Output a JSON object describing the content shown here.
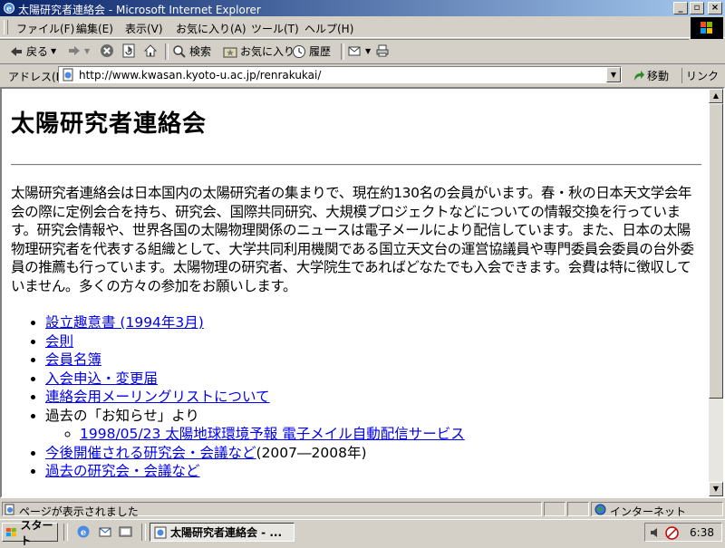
{
  "window": {
    "title": "太陽研究者連絡会 - Microsoft Internet Explorer"
  },
  "menu": [
    "ファイル(F)",
    "編集(E)",
    "表示(V)",
    "お気に入り(A)",
    "ツール(T)",
    "ヘルプ(H)"
  ],
  "toolbar": {
    "back": "戻る",
    "search": "検索",
    "favorites": "お気に入り",
    "history": "履歴"
  },
  "address": {
    "label": "アドレス(D)",
    "url": "http://www.kwasan.kyoto-u.ac.jp/renrakukai/",
    "go": "移動",
    "links": "リンク"
  },
  "page": {
    "heading": "太陽研究者連絡会",
    "intro": "太陽研究者連絡会は日本国内の太陽研究者の集まりで、現在約130名の会員がいます。春・秋の日本天文学会年会の際に定例会合を持ち、研究会、国際共同研究、大規模プロジェクトなどについての情報交換を行っています。研究会情報や、世界各国の太陽物理関係のニュースは電子メールにより配信しています。また、日本の太陽物理研究者を代表する組織として、大学共同利用機関である国立天文台の運営協議員や専門委員会委員の台外委員の推薦も行っています。太陽物理の研究者、大学院生であればどなたでも入会できます。会費は特に徴収していません。多くの方々の参加をお願いします。",
    "links": {
      "prospectus": "設立趣意書 (1994年3月)",
      "rules": "会則",
      "members": "会員名簿",
      "join": "入会申込・変更届",
      "mailinglist": "連絡会用メーリングリストについて",
      "news_label": "過去の「お知らせ」より",
      "news_item": "1998/05/23 太陽地球環境予報 電子メイル自動配信サービス",
      "upcoming": "今後開催される研究会・会議など",
      "upcoming_note": "(2007―2008年)",
      "past": "過去の研究会・会議など"
    }
  },
  "status": {
    "text": "ページが表示されました",
    "zone": "インターネット"
  },
  "taskbar": {
    "start": "スタート",
    "task": "太陽研究者連絡会 - ...",
    "clock": "6:38"
  },
  "icons": {
    "ie": "ie-logo-icon",
    "back": "back-arrow-icon",
    "forward": "forward-arrow-icon",
    "stop": "stop-icon",
    "refresh": "refresh-icon",
    "home": "home-icon",
    "search": "search-icon",
    "favorites": "favorites-icon",
    "history": "history-icon",
    "mail": "mail-icon",
    "print": "print-icon"
  }
}
